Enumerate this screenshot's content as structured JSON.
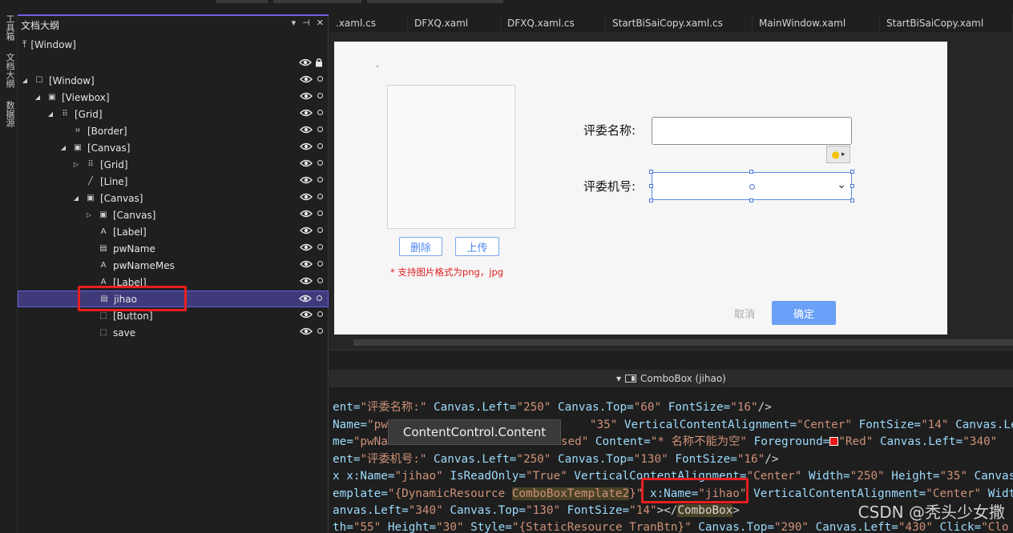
{
  "vertical_tabs": [
    "工具箱",
    "文档大纲",
    "数据源"
  ],
  "outline": {
    "title": "文档大纲",
    "tool_pin": "▾ ⊣ ✕",
    "root_up": "[Window]",
    "tree": [
      {
        "label": "[Window]",
        "icon": "window-icon",
        "glyph": "☐",
        "expander": "◢",
        "depth": 0
      },
      {
        "label": "[Viewbox]",
        "icon": "viewbox-icon",
        "glyph": "▣",
        "expander": "◢",
        "depth": 1
      },
      {
        "label": "[Grid]",
        "icon": "grid-icon",
        "glyph": "⠿",
        "expander": "◢",
        "depth": 2
      },
      {
        "label": "[Border]",
        "icon": "border-icon",
        "glyph": "⌗",
        "expander": "",
        "depth": 3
      },
      {
        "label": "[Canvas]",
        "icon": "canvas-icon",
        "glyph": "▣",
        "expander": "◢",
        "depth": 3
      },
      {
        "label": "[Grid]",
        "icon": "grid-icon",
        "glyph": "⠿",
        "expander": "▷",
        "depth": 4
      },
      {
        "label": "[Line]",
        "icon": "line-icon",
        "glyph": "╱",
        "expander": "",
        "depth": 4
      },
      {
        "label": "[Canvas]",
        "icon": "canvas-icon",
        "glyph": "▣",
        "expander": "◢",
        "depth": 4
      },
      {
        "label": "[Canvas]",
        "icon": "canvas-icon",
        "glyph": "▣",
        "expander": "▷",
        "depth": 5
      },
      {
        "label": "[Label]",
        "icon": "label-icon",
        "glyph": "A",
        "expander": "",
        "depth": 5
      },
      {
        "label": "pwName",
        "icon": "textbox-icon",
        "glyph": "▤",
        "expander": "",
        "depth": 5
      },
      {
        "label": "pwNameMes",
        "icon": "label-icon",
        "glyph": "A",
        "expander": "",
        "depth": 5
      },
      {
        "label": "[Label]",
        "icon": "label-icon",
        "glyph": "A",
        "expander": "",
        "depth": 5
      },
      {
        "label": "jihao",
        "icon": "combobox-icon",
        "glyph": "▤",
        "expander": "",
        "depth": 5,
        "selected": true
      },
      {
        "label": "[Button]",
        "icon": "button-icon",
        "glyph": "⬚",
        "expander": "",
        "depth": 5
      },
      {
        "label": "save",
        "icon": "button-icon",
        "glyph": "⬚",
        "expander": "",
        "depth": 5
      }
    ]
  },
  "tabs": [
    ".xaml.cs",
    "DFXQ.xaml",
    "DFXQ.xaml.cs",
    "StartBiSaiCopy.xaml.cs",
    "MainWindow.xaml",
    "StartBiSaiCopy.xaml"
  ],
  "designer": {
    "dot": "·",
    "delete_button": "删除",
    "upload_button": "上传",
    "hint": "* 支持图片格式为png，jpg",
    "judge_name_label": "评委名称:",
    "judge_id_label": "评委机号:",
    "combo_arrow": "⌄",
    "cancel_button": "取消",
    "ok_button": "确定"
  },
  "breadcrumb": {
    "arrow": "▾",
    "text": "ComboBox (jihao)"
  },
  "tooltip": "ContentControl.Content",
  "code": {
    "l1": {
      "a": "ent=",
      "b": "\"评委名称:\"",
      "c": " Canvas.Left=",
      "d": "\"250\"",
      "e": " Canvas.Top=",
      "f": "\"60\"",
      "g": " FontSize=",
      "h": "\"16\"",
      "i": "/>"
    },
    "l2": {
      "a": "Name=",
      "b": "\"pw",
      "c": "\"35\"",
      "d": " VerticalContentAlignment=",
      "e": "\"Center\"",
      "f": " FontSize=",
      "g": "\"14\"",
      "h": " Canvas.Left="
    },
    "l3": {
      "a": "me=",
      "b": "\"pwNa",
      "c": "sed\"",
      "d": " Content=",
      "e": "\"* 名称不能为空\"",
      "f": " Foreground=",
      "g": "\"Red\"",
      "h": " Canvas.Left=",
      "i": "\"340\""
    },
    "l4": {
      "a": "ent=",
      "b": "\"评委机号:\"",
      "c": " Canvas.Left=",
      "d": "\"250\"",
      "e": " Canvas.Top=",
      "f": "\"130\"",
      "g": " FontSize=",
      "h": "\"16\"",
      "i": "/>"
    },
    "l5": {
      "a": "x x:Name=",
      "b": "\"jihao\"",
      "c": " IsReadOnly=",
      "d": "\"True\"",
      "e": " VerticalContentAlignment=",
      "f": "\"Center\"",
      "g": " Width=",
      "h": "\"250\"",
      "i": " Height=",
      "j": "\"35\"",
      "k": " Canvas"
    },
    "l6": {
      "a": "emplate=",
      "b": "\"{DynamicResource ",
      "c": "ComboBoxTemplate2",
      "d": "}\"",
      "e": " x:Name=",
      "f": "\"jihao\"",
      "g": " VerticalContentAlignment=",
      "h": "\"Center\"",
      "i": " Widt"
    },
    "l7": {
      "a": "anvas.Left=",
      "b": "\"340\"",
      "c": " Canvas.Top=",
      "d": "\"130\"",
      "e": " FontSize=",
      "f": "\"14\"",
      "g": "></",
      "h": "ComboBox",
      "i": ">"
    },
    "l8": {
      "a": "th=",
      "b": "\"55\"",
      "c": " Height=",
      "d": "\"30\"",
      "e": " Style=",
      "f": "\"{StaticResource TranBtn}\"",
      "g": " Canvas.Top=",
      "h": "\"290\"",
      "i": " Canvas.Left=",
      "j": "\"430\"",
      "k": " Click=",
      "l": "\"Clo"
    }
  },
  "watermark": "CSDN @秃头少女撒"
}
